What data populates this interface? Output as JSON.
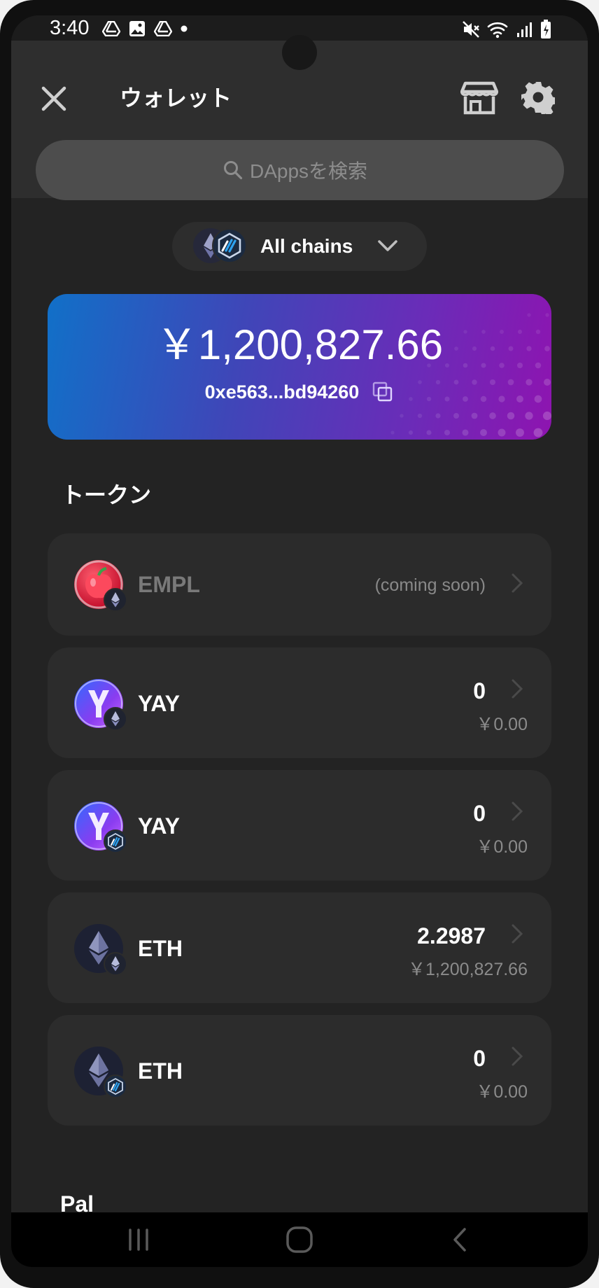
{
  "status_bar": {
    "time": "3:40"
  },
  "header": {
    "title": "ウォレット",
    "search_placeholder": "DAppsを検索"
  },
  "chain_selector": {
    "label": "All chains"
  },
  "balance_card": {
    "balance": "￥1,200,827.66",
    "address": "0xe563...bd94260"
  },
  "tokens_section": {
    "title": "トークン",
    "items": [
      {
        "symbol": "EMPL",
        "amount": "",
        "value": "",
        "status": "(coming soon)",
        "icon": "empl-apple-icon",
        "chain": "ethereum-badge-icon"
      },
      {
        "symbol": "YAY",
        "amount": "0",
        "value": "￥0.00",
        "status": "",
        "icon": "yay-icon",
        "chain": "ethereum-badge-icon"
      },
      {
        "symbol": "YAY",
        "amount": "0",
        "value": "￥0.00",
        "status": "",
        "icon": "yay-icon",
        "chain": "arbitrum-badge-icon"
      },
      {
        "symbol": "ETH",
        "amount": "2.2987",
        "value": "￥1,200,827.66",
        "status": "",
        "icon": "eth-icon",
        "chain": "ethereum-badge-icon"
      },
      {
        "symbol": "ETH",
        "amount": "0",
        "value": "￥0.00",
        "status": "",
        "icon": "eth-icon",
        "chain": "arbitrum-badge-icon"
      }
    ]
  },
  "pal_section": {
    "title": "Pal"
  },
  "colors": {
    "background": "#232323",
    "card_gradient_start": "#1170c8",
    "card_gradient_end": "#8e14b0",
    "row_background": "#2c2c2c",
    "muted_text": "#8b8b8b"
  }
}
